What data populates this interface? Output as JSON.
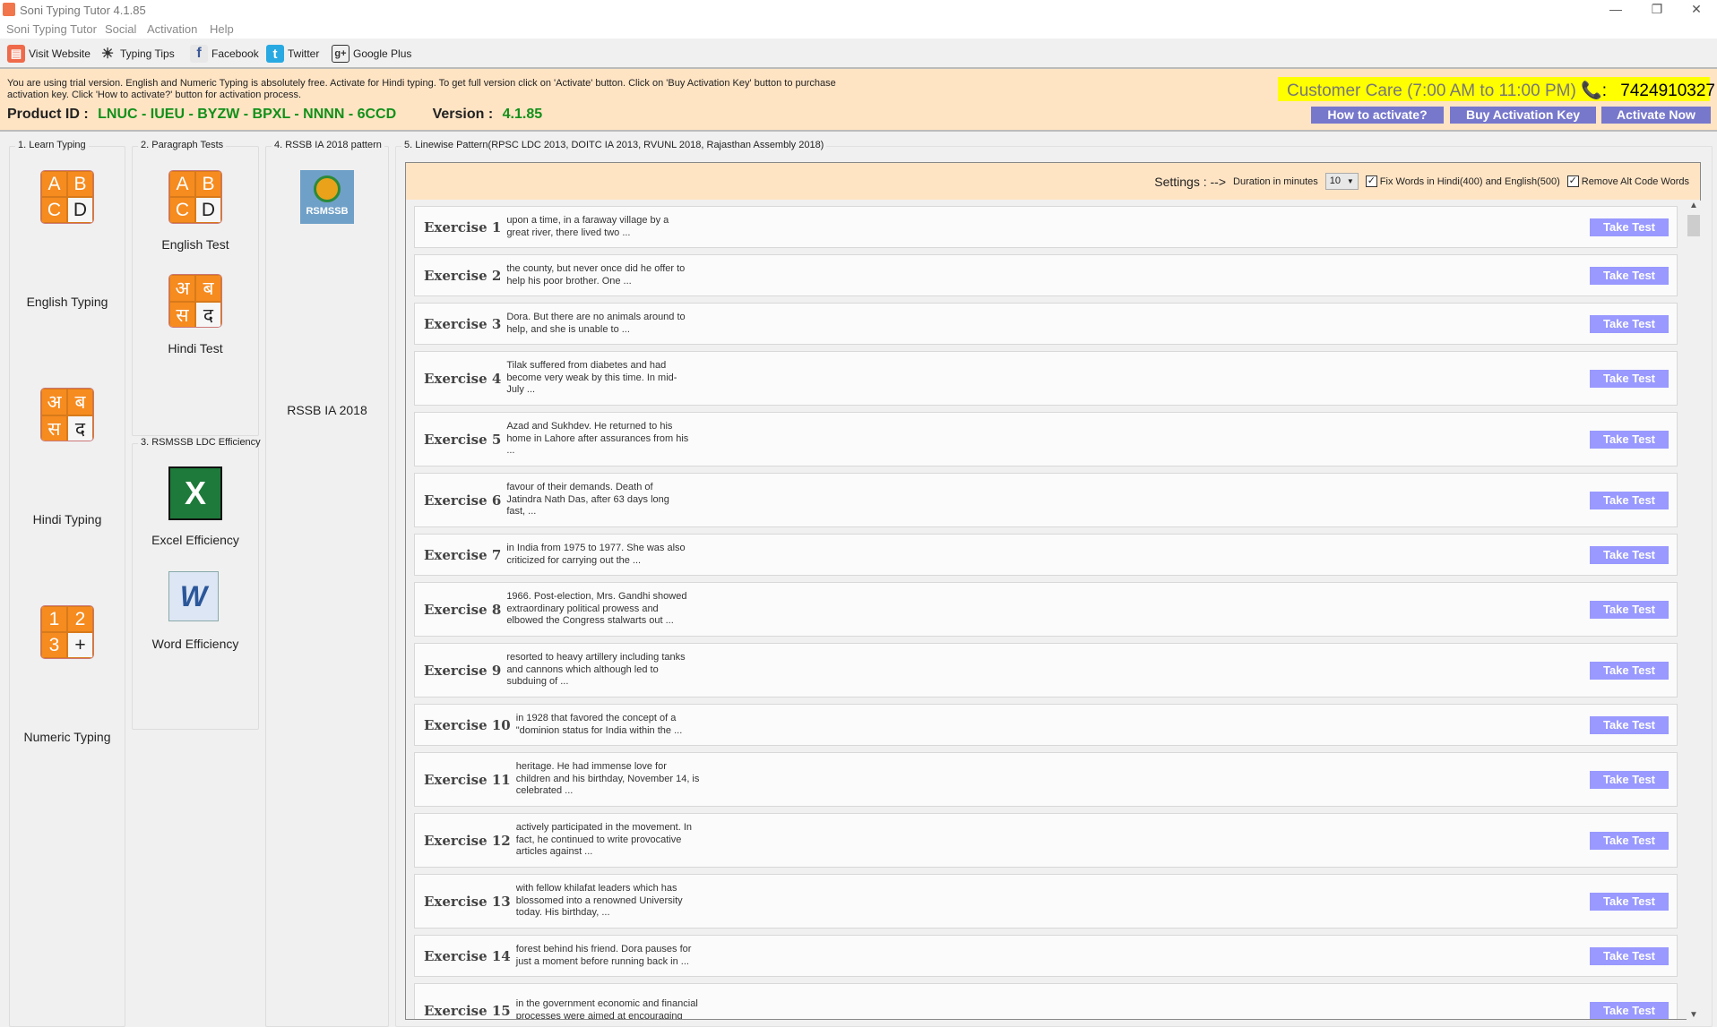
{
  "window": {
    "title": "Soni Typing Tutor 4.1.85",
    "minimize": "—",
    "maximize": "❐",
    "close": "✕"
  },
  "menu": [
    "Soni Typing Tutor",
    "Social",
    "Activation",
    "Help"
  ],
  "toolbar": [
    {
      "label": "Visit Website",
      "icon": "website-icon"
    },
    {
      "label": "Typing Tips",
      "icon": "lightbulb-icon"
    },
    {
      "label": "Facebook",
      "icon": "facebook-icon"
    },
    {
      "label": "Twitter",
      "icon": "twitter-icon"
    },
    {
      "label": "Google Plus",
      "icon": "google-plus-icon"
    }
  ],
  "banner": {
    "trial_text": "You are using trial version. English and Numeric Typing is absolutely free. Activate for Hindi typing. To get full version click on 'Activate' button. Click on 'Buy Activation Key' button to purchase activation key. Click 'How to activate?' button for activation process.",
    "product_id_label": "Product ID :",
    "product_id": "LNUC - IUEU - BYZW - BPXL - NNNN - 6CCD",
    "version_label": "Version :",
    "version": "4.1.85",
    "customer_care": "Customer Care (7:00 AM to 11:00 PM)",
    "phone_sep": ":",
    "phone": "7424910327",
    "buttons": [
      "How to activate?",
      "Buy Activation Key",
      "Activate Now"
    ]
  },
  "groups": {
    "learn": {
      "title": "1. Learn Typing",
      "items": [
        "English Typing",
        "Hindi Typing",
        "Numeric Typing"
      ]
    },
    "paragraph": {
      "title": "2. Paragraph Tests",
      "items": [
        "English Test",
        "Hindi Test"
      ]
    },
    "ldc": {
      "title": "3. RSMSSB LDC Efficiency",
      "items": [
        "Excel Efficiency",
        "Word Efficiency"
      ]
    },
    "rssb": {
      "title": "4. RSSB IA 2018 pattern",
      "logo_text": "RSMSSB",
      "item": "RSSB IA 2018"
    },
    "linewise": {
      "title": "5. Linewise Pattern(RPSC LDC 2013, DOITC IA 2013, RVUNL 2018, Rajasthan Assembly 2018)"
    }
  },
  "tiles": {
    "english": [
      "A",
      "B",
      "C",
      "D"
    ],
    "hindi": [
      "अ",
      "ब",
      "स",
      "द"
    ],
    "numeric": [
      "1",
      "2",
      "3",
      "+"
    ]
  },
  "settings": {
    "label": "Settings : -->",
    "duration_label": "Duration in minutes",
    "duration": "10",
    "fix_words": "Fix Words in Hindi(400) and English(500)",
    "fix_words_checked": true,
    "remove_alt": "Remove Alt Code Words",
    "remove_alt_checked": true
  },
  "take_test_label": "Take Test",
  "accent": {
    "orange": "#f68b1f",
    "take_test": "#9999ff",
    "activate": "#7777cc",
    "banner": "#ffe4c4",
    "care": "#ffff00"
  },
  "exercises": [
    {
      "name": "Exercise 1",
      "text": "upon a time, in a faraway village by a great river, there lived two ..."
    },
    {
      "name": "Exercise 2",
      "text": "the county, but never once did he offer to help his poor brother. One ..."
    },
    {
      "name": "Exercise 3",
      "text": "Dora. But there are no animals around to help, and she is unable to ..."
    },
    {
      "name": "Exercise 4",
      "text": "Tilak suffered from diabetes and had become very weak by this time. In mid-July ..."
    },
    {
      "name": "Exercise 5",
      "text": "Azad and Sukhdev. He returned to his home in Lahore after assurances from his ..."
    },
    {
      "name": "Exercise 6",
      "text": "favour of their demands. Death of Jatindra Nath Das, after 63 days long fast, ..."
    },
    {
      "name": "Exercise 7",
      "text": "in India from 1975 to 1977. She was also criticized for carrying out the ..."
    },
    {
      "name": "Exercise 8",
      "text": "1966. Post-election, Mrs. Gandhi showed extraordinary political prowess and elbowed the Congress stalwarts out ..."
    },
    {
      "name": "Exercise 9",
      "text": "resorted to heavy artillery including tanks and cannons which although led to subduing of ..."
    },
    {
      "name": "Exercise 10",
      "text": "in 1928 that favored the concept of a \"dominion status for India within the ..."
    },
    {
      "name": "Exercise 11",
      "text": "heritage. He had immense love for children and his birthday, November 14, is celebrated ..."
    },
    {
      "name": "Exercise 12",
      "text": "actively participated in the movement. In fact, he continued to write provocative articles against ..."
    },
    {
      "name": "Exercise 13",
      "text": "with fellow khilafat leaders which has blossomed into a renowned University today. His birthday, ..."
    },
    {
      "name": "Exercise 14",
      "text": "forest behind his friend. Dora pauses for just a moment before running back in ..."
    },
    {
      "name": "Exercise 15",
      "text": "in the government economic and financial processes were aimed at encouraging"
    }
  ]
}
